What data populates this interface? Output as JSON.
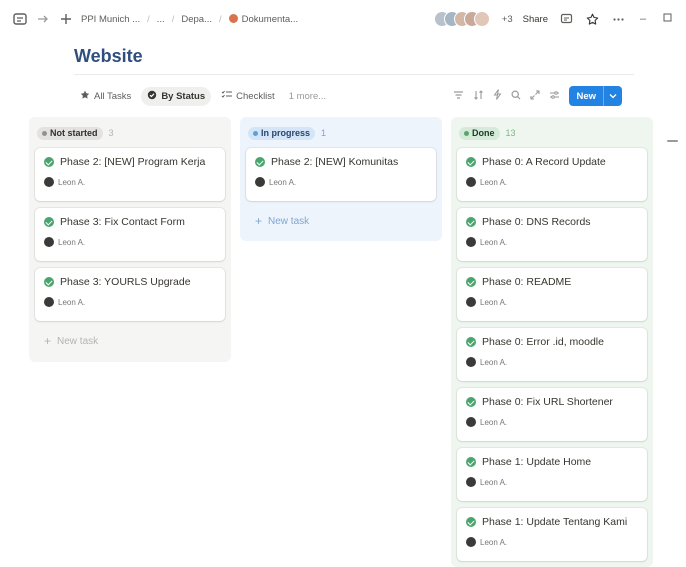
{
  "topbar": {
    "breadcrumbs": [
      {
        "label": "PPI Munich ..."
      },
      {
        "label": "..."
      },
      {
        "label": "Depa..."
      },
      {
        "label": "Dokumenta..."
      }
    ],
    "collaborators_extra": "+3",
    "share_label": "Share"
  },
  "page": {
    "title": "Website"
  },
  "views": {
    "tabs": [
      {
        "label": "All Tasks",
        "icon": "star-icon"
      },
      {
        "label": "By Status",
        "icon": "status-circle-icon",
        "active": true
      },
      {
        "label": "Checklist",
        "icon": "checklist-icon"
      }
    ],
    "more_label": "1 more...",
    "new_button_label": "New"
  },
  "board": {
    "columns": [
      {
        "status": "Not started",
        "count": "3",
        "color": "#91918e",
        "cards": [
          {
            "title": "Phase 2: [NEW] Program Kerja",
            "assignee": "Leon A."
          },
          {
            "title": "Phase 3: Fix Contact Form",
            "assignee": "Leon A."
          },
          {
            "title": "Phase 3: YOURLS Upgrade",
            "assignee": "Leon A."
          }
        ],
        "new_task_label": "New task"
      },
      {
        "status": "In progress",
        "count": "1",
        "color": "#5e9fd8",
        "cards": [
          {
            "title": "Phase 2: [NEW] Komunitas",
            "assignee": "Leon A."
          }
        ],
        "new_task_label": "New task"
      },
      {
        "status": "Done",
        "count": "13",
        "color": "#5aa56a",
        "cards": [
          {
            "title": "Phase 0: A Record Update",
            "assignee": "Leon A."
          },
          {
            "title": "Phase 0: DNS Records",
            "assignee": "Leon A."
          },
          {
            "title": "Phase 0: README",
            "assignee": "Leon A."
          },
          {
            "title": "Phase 0: Error .id, moodle",
            "assignee": "Leon A."
          },
          {
            "title": "Phase 0: Fix URL Shortener",
            "assignee": "Leon A."
          },
          {
            "title": "Phase 1: Update Home",
            "assignee": "Leon A."
          },
          {
            "title": "Phase 1: Update Tentang Kami",
            "assignee": "Leon A."
          }
        ]
      }
    ]
  }
}
